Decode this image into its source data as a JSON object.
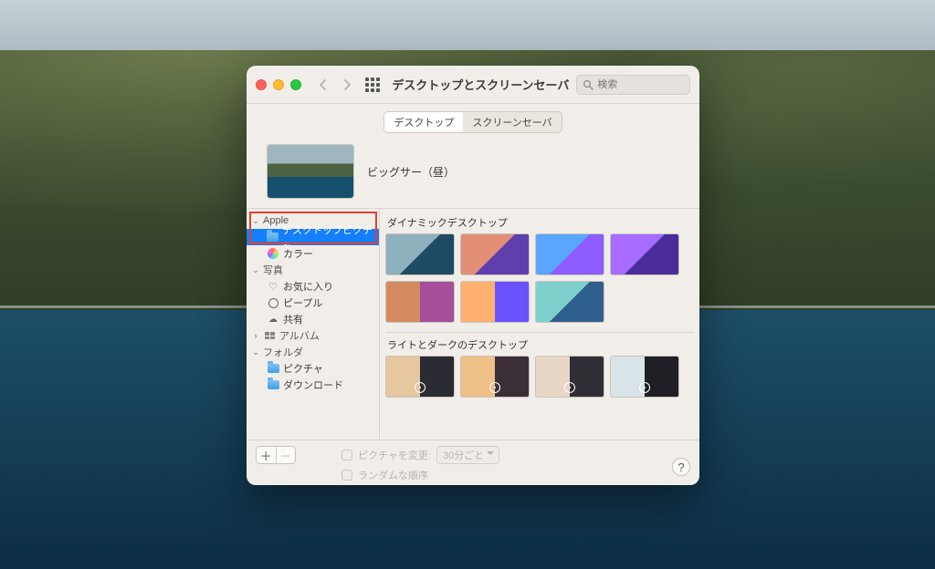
{
  "window": {
    "title": "デスクトップとスクリーンセーバ",
    "search_placeholder": "検索",
    "tabs": {
      "desktop": "デスクトップ",
      "screensaver": "スクリーンセーバ"
    },
    "current_wallpaper_name": "ビッグサー（昼）"
  },
  "sidebar": {
    "groups": [
      {
        "name": "Apple",
        "items": [
          {
            "label": "デスクトップピクチャ",
            "icon": "folder",
            "selected": true
          },
          {
            "label": "カラー",
            "icon": "color"
          }
        ]
      },
      {
        "name": "写真",
        "items": [
          {
            "label": "お気に入り",
            "icon": "heart"
          },
          {
            "label": "ピープル",
            "icon": "people"
          },
          {
            "label": "共有",
            "icon": "cloud"
          }
        ]
      },
      {
        "name": "アルバム",
        "items": []
      },
      {
        "name": "フォルダ",
        "items": [
          {
            "label": "ピクチャ",
            "icon": "folder"
          },
          {
            "label": "ダウンロード",
            "icon": "folder"
          }
        ]
      }
    ]
  },
  "gallery": {
    "section_dynamic": "ダイナミックデスクトップ",
    "section_lightdark": "ライトとダークのデスクトップ"
  },
  "bottom": {
    "change_picture": "ピクチャを変更:",
    "interval": "30分ごと",
    "random_order": "ランダムな順序"
  }
}
